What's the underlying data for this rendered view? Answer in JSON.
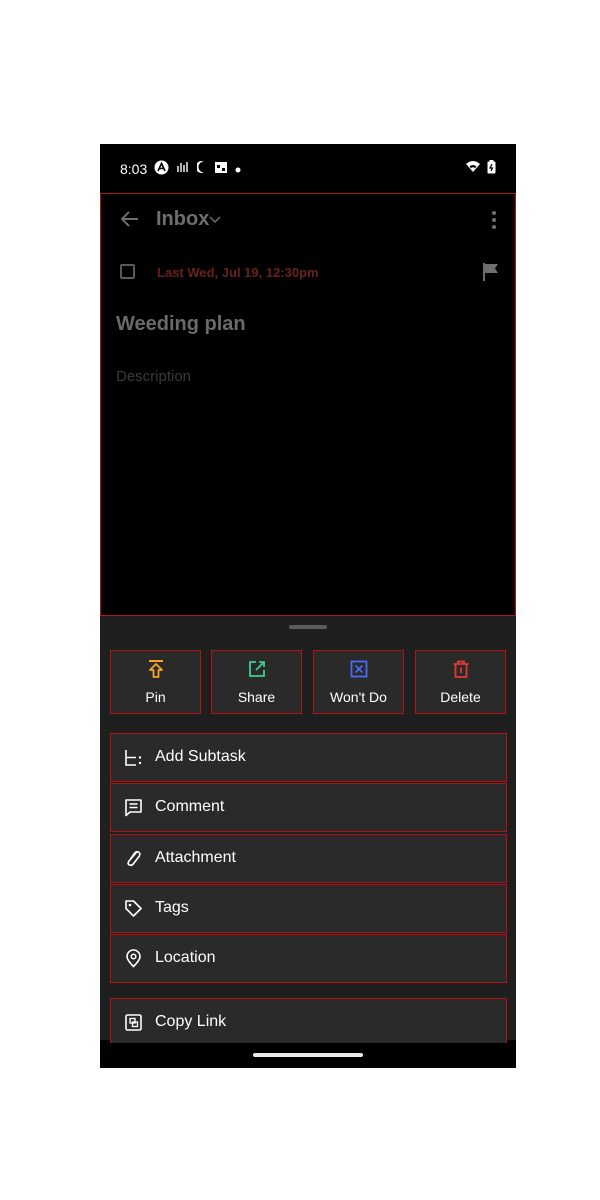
{
  "status_bar": {
    "time": "8:03",
    "icons": [
      "app-a-icon",
      "antenna-icon",
      "moon-icon",
      "calendar-icon",
      "dot-icon"
    ],
    "right_icons": [
      "wifi-icon",
      "battery-icon"
    ]
  },
  "task": {
    "list_name": "Inbox",
    "due_date": "Last Wed, Jul 19, 12:30pm",
    "title": "Weeding plan",
    "description_placeholder": "Description"
  },
  "actions": [
    {
      "label": "Pin",
      "icon": "pin-icon",
      "color": "#f5a623"
    },
    {
      "label": "Share",
      "icon": "share-icon",
      "color": "#3ecf8e"
    },
    {
      "label": "Won't Do",
      "icon": "wont-do-icon",
      "color": "#4a6cf7"
    },
    {
      "label": "Delete",
      "icon": "trash-icon",
      "color": "#e53935"
    }
  ],
  "menu": [
    {
      "label": "Add Subtask",
      "icon": "subtask-icon"
    },
    {
      "label": "Comment",
      "icon": "comment-icon"
    },
    {
      "label": "Attachment",
      "icon": "paperclip-icon"
    },
    {
      "label": "Tags",
      "icon": "tag-icon"
    },
    {
      "label": "Location",
      "icon": "location-pin-icon"
    },
    {
      "label": "Copy Link",
      "icon": "copy-link-icon"
    }
  ],
  "colors": {
    "background": "#000000",
    "sheet": "#1f1f1f",
    "item": "#2a2a2a",
    "highlight_border": "#b01515",
    "due_date": "#6b2020"
  }
}
